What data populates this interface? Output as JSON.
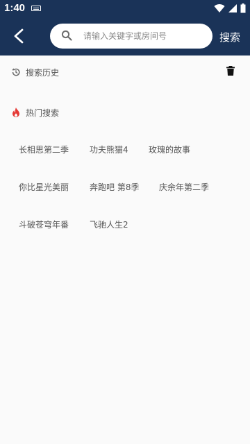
{
  "status_bar": {
    "time": "1:40",
    "icons": [
      "keyboard-icon",
      "wifi-icon",
      "signal-icon",
      "battery-icon"
    ]
  },
  "toolbar": {
    "back_icon": "chevron-left-icon",
    "search_placeholder": "请输入关键字或房间号",
    "search_value": "",
    "search_button": "搜索"
  },
  "history": {
    "icon": "history-icon",
    "title": "搜索历史",
    "clear_icon": "trash-icon",
    "items": []
  },
  "hot": {
    "icon": "flame-icon",
    "title": "热门搜索",
    "tags": [
      "长相思第二季",
      "功夫熊猫4",
      "玫瑰的故事",
      "你比星光美丽",
      "奔跑吧 第8季",
      "庆余年第二季",
      "斗破苍穹年番",
      "飞驰人生2"
    ]
  },
  "colors": {
    "header_bg": "#1a3358",
    "page_bg": "#fafafa",
    "flame": "#e53935"
  }
}
